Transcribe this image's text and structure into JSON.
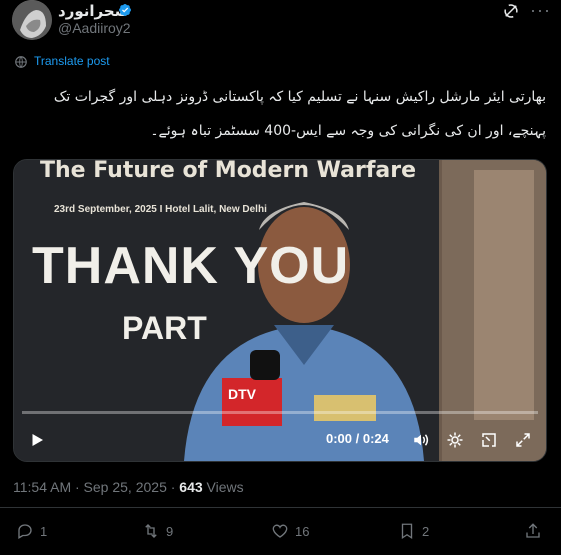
{
  "author": {
    "display_name": "صحرانورد",
    "handle": "@Aadiiroy2",
    "verified_badge": "verified-badge"
  },
  "translate_label": "Translate post",
  "post_text": "بھارتی ایئر مارشل راکیش سنہا نے تسلیم کیا کہ پاکستانی ڈرونز دہلی اور گجرات تک پہنچے، اور ان کی نگرانی کی وجہ سے ایس-400 سسٹمز تباہ ہوئے۔",
  "video": {
    "banner_title": "The Future of Modern Warfare",
    "banner_date": "23rd September, 2025 I Hotel Lalit, New Delhi",
    "thank_text": "THANK YOU",
    "part_text": "PART",
    "mic_label": "DTV",
    "time": "0:00 / 0:24",
    "progress": 0
  },
  "timestamp": "11:54 AM · Sep 25, 2025 · ",
  "views_count": "643",
  "views_label": " Views",
  "actions": {
    "replies": "1",
    "reposts": "9",
    "likes": "16",
    "bookmarks": "2"
  },
  "colors": {
    "accent": "#1d9bf0",
    "muted": "#71767b",
    "text": "#e7e9ea",
    "background": "#000000"
  }
}
